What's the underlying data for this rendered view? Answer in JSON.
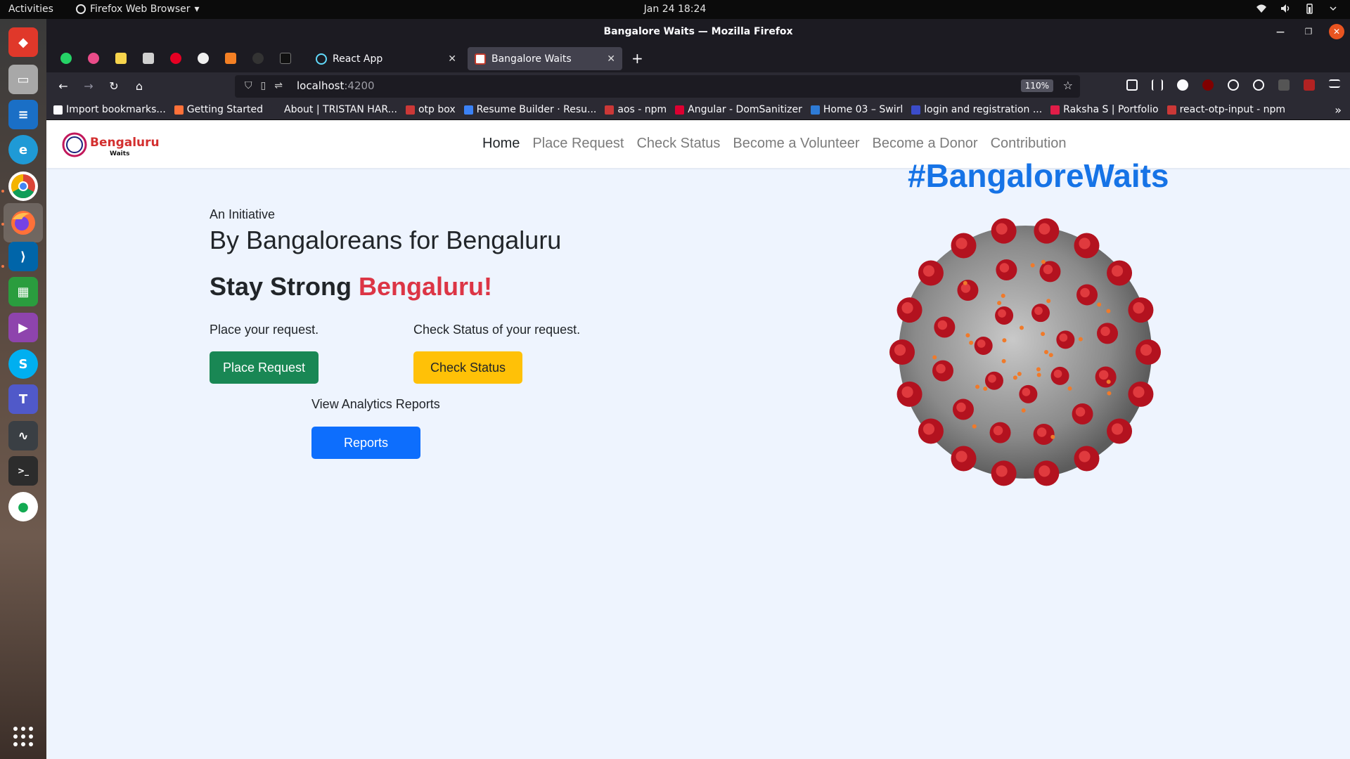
{
  "topbar": {
    "activities": "Activities",
    "app_menu": "Firefox Web Browser",
    "clock": "Jan 24  18:24"
  },
  "window": {
    "title": "Bangalore Waits — Mozilla Firefox"
  },
  "tabs": [
    {
      "label": "React App",
      "active": false
    },
    {
      "label": "Bangalore Waits",
      "active": true
    }
  ],
  "urlbar": {
    "host": "localhost",
    "port": ":4200",
    "zoom": "110%"
  },
  "bookmarks": [
    {
      "label": "Import bookmarks...",
      "color": "#fbfbfe"
    },
    {
      "label": "Getting Started",
      "color": "#ff7139"
    },
    {
      "label": "About | TRISTAN HAR...",
      "color": "#2b2a33"
    },
    {
      "label": "otp box",
      "color": "#cb3837"
    },
    {
      "label": "Resume Builder · Resu...",
      "color": "#3b82f6"
    },
    {
      "label": "aos - npm",
      "color": "#cb3837"
    },
    {
      "label": "Angular - DomSanitizer",
      "color": "#dd0031"
    },
    {
      "label": "Home 03 – Swirl",
      "color": "#2e7bd6"
    },
    {
      "label": "login and registration ...",
      "color": "#3b4cca"
    },
    {
      "label": "Raksha S | Portfolio",
      "color": "#e11d48"
    },
    {
      "label": "react-otp-input - npm",
      "color": "#cb3837"
    }
  ],
  "site": {
    "logo_text": "Bengaluru",
    "logo_sub": "Waits",
    "nav": [
      "Home",
      "Place Request",
      "Check Status",
      "Become a Volunteer",
      "Become a Donor",
      "Contribution"
    ],
    "initiative": "An Initiative",
    "headline": "By Bangaloreans for Bengaluru",
    "stay_strong": "Stay Strong ",
    "stay_strong_highlight": "Bengaluru!",
    "place_label": "Place your request.",
    "check_label": "Check Status of your request.",
    "place_button": "Place Request",
    "check_button": "Check Status",
    "analytics_label": "View Analytics Reports",
    "reports_button": "Reports",
    "hashtag": "#BangaloreWaits"
  },
  "colors": {
    "accent_red": "#dc3545",
    "button_green": "#198754",
    "button_yellow": "#ffc107",
    "button_blue": "#0d6efd",
    "hashtag_blue": "#1673e6"
  }
}
